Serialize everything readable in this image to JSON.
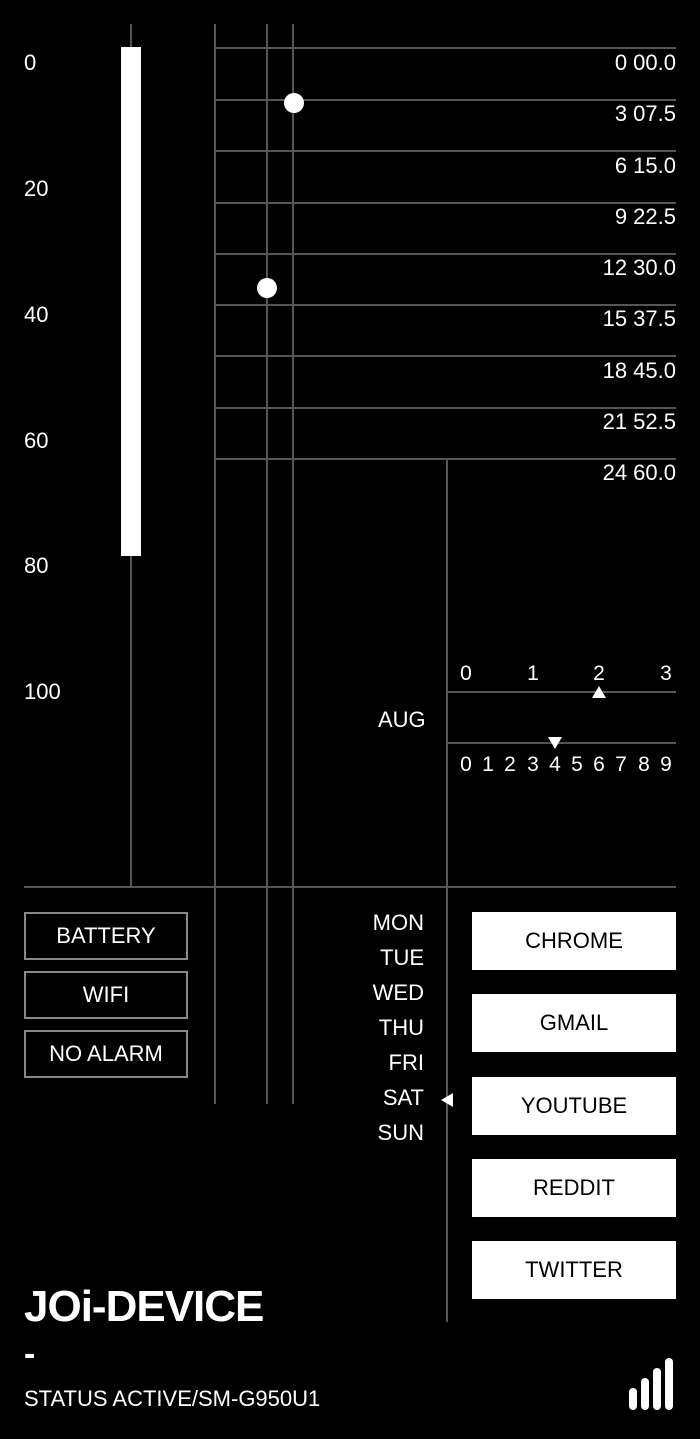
{
  "left_scale": {
    "labels": [
      "0",
      "20",
      "40",
      "60",
      "80",
      "100"
    ],
    "level_bar": {
      "from": 0,
      "to": 78,
      "max": 100
    }
  },
  "time_grid": {
    "rows": [
      "0 00.0",
      "3 07.5",
      "6 15.0",
      "9 22.5",
      "12 30.0",
      "15 37.5",
      "18 45.0",
      "21 52.5",
      "24 60.0"
    ]
  },
  "date_display": {
    "month": "AUG",
    "tens_digits": [
      "0",
      "1",
      "2",
      "3"
    ],
    "ones_digits": [
      "0",
      "1",
      "2",
      "3",
      "4",
      "5",
      "6",
      "7",
      "8",
      "9"
    ],
    "tens_selected": "2",
    "ones_selected": "4"
  },
  "status_buttons": [
    {
      "label": "BATTERY"
    },
    {
      "label": "WIFI"
    },
    {
      "label": "NO ALARM"
    }
  ],
  "weekdays": {
    "days": [
      "MON",
      "TUE",
      "WED",
      "THU",
      "FRI",
      "SAT",
      "SUN"
    ],
    "selected": "SAT"
  },
  "apps": [
    {
      "label": "CHROME"
    },
    {
      "label": "GMAIL"
    },
    {
      "label": "YOUTUBE"
    },
    {
      "label": "REDDIT"
    },
    {
      "label": "TWITTER"
    }
  ],
  "footer": {
    "title": "JOi-DEVICE",
    "dash": "-",
    "status": "STATUS ACTIVE/SM-G950U1",
    "signal_icon": "signal-bars-icon"
  }
}
